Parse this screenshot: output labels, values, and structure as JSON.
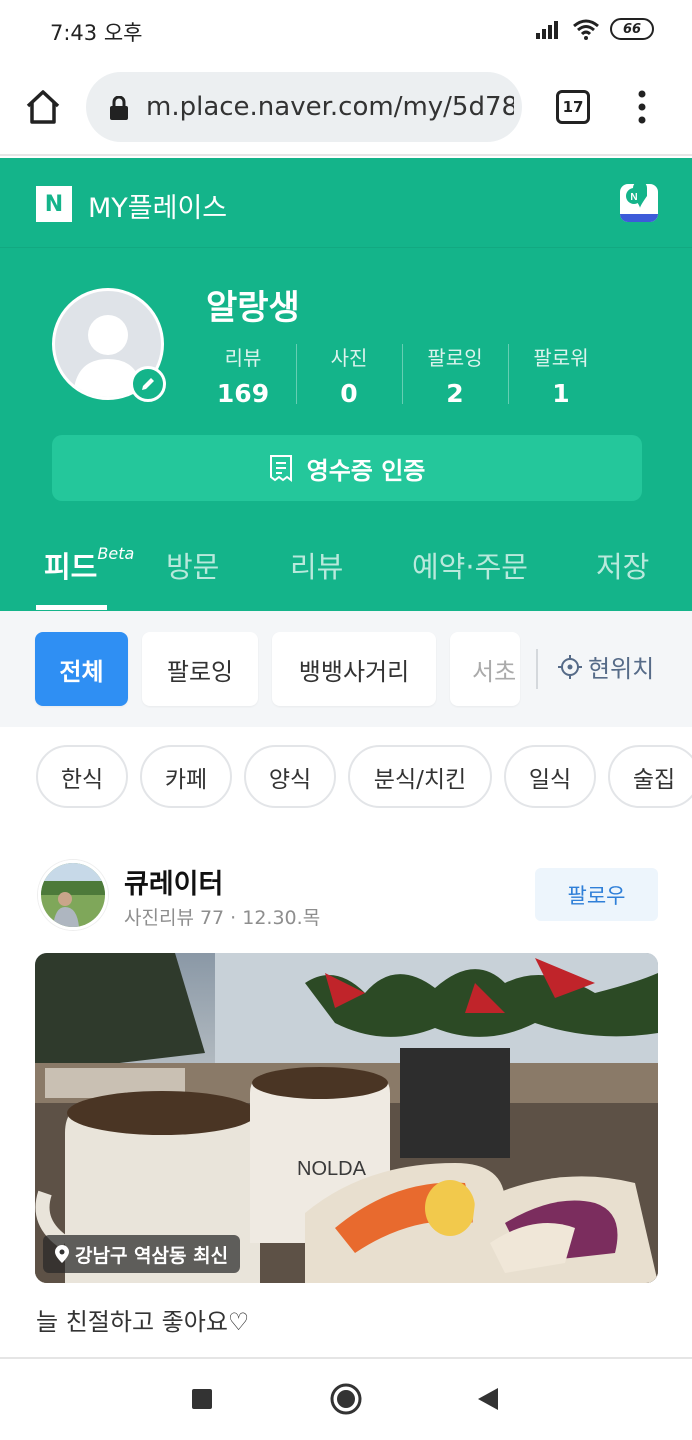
{
  "status": {
    "time": "7:43 오후",
    "battery": "66"
  },
  "browser": {
    "url": "m.place.naver.com/my/5d78",
    "tab_count": "17"
  },
  "header": {
    "logo": "N",
    "brand": "MY플레이스"
  },
  "profile": {
    "name": "알랑생",
    "stats": [
      {
        "label": "리뷰",
        "value": "169"
      },
      {
        "label": "사진",
        "value": "0"
      },
      {
        "label": "팔로잉",
        "value": "2"
      },
      {
        "label": "팔로워",
        "value": "1"
      }
    ],
    "receipt_button": "영수증 인증"
  },
  "tabs": [
    {
      "label": "피드",
      "badge": "Beta"
    },
    {
      "label": "방문"
    },
    {
      "label": "리뷰"
    },
    {
      "label": "예약·주문"
    },
    {
      "label": "저장"
    }
  ],
  "filters": {
    "chips": [
      "전체",
      "팔로잉",
      "뱅뱅사거리",
      "서초"
    ],
    "location_button": "현위치"
  },
  "categories": [
    "한식",
    "카페",
    "양식",
    "분식/치킨",
    "일식",
    "술집"
  ],
  "feed": {
    "author": "큐레이터",
    "meta": "사진리뷰 77 · 12.30.목",
    "follow_label": "팔로우",
    "location_tag": "강남구 역삼동 최신",
    "review": "늘 친절하고 좋아요♡",
    "mug_text": "NOLDA"
  },
  "colors": {
    "brand_green": "#14b48a",
    "chip_active": "#2f8ff3",
    "follow_text": "#2f7fd8"
  }
}
